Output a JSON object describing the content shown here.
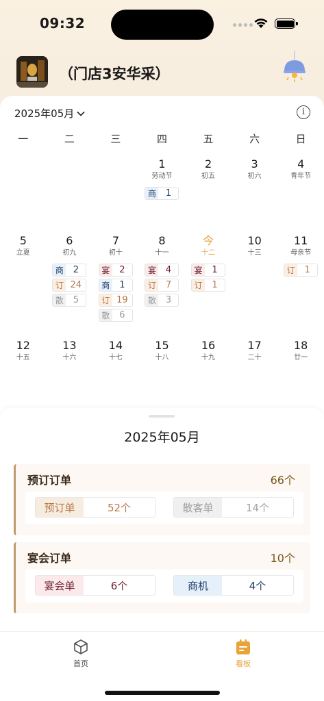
{
  "status_bar": {
    "time": "09:32"
  },
  "store": {
    "name": "（门店3安华采）"
  },
  "calendar": {
    "month_label": "2025年05月",
    "weekdays": [
      "一",
      "二",
      "三",
      "四",
      "五",
      "六",
      "日"
    ],
    "weeks": [
      [
        {
          "day": "",
          "sub": ""
        },
        {
          "day": "",
          "sub": ""
        },
        {
          "day": "",
          "sub": ""
        },
        {
          "day": "1",
          "sub": "劳动节",
          "badges": [
            {
              "type": "商",
              "count": "1"
            }
          ]
        },
        {
          "day": "2",
          "sub": "初五"
        },
        {
          "day": "3",
          "sub": "初六"
        },
        {
          "day": "4",
          "sub": "青年节"
        }
      ],
      [
        {
          "day": "5",
          "sub": "立夏"
        },
        {
          "day": "6",
          "sub": "初九",
          "badges": [
            {
              "type": "商",
              "count": "2"
            },
            {
              "type": "订",
              "count": "24"
            },
            {
              "type": "散",
              "count": "5"
            }
          ]
        },
        {
          "day": "7",
          "sub": "初十",
          "badges": [
            {
              "type": "宴",
              "count": "2"
            },
            {
              "type": "商",
              "count": "1"
            },
            {
              "type": "订",
              "count": "19"
            },
            {
              "type": "散",
              "count": "6"
            }
          ]
        },
        {
          "day": "8",
          "sub": "十一",
          "badges": [
            {
              "type": "宴",
              "count": "4"
            },
            {
              "type": "订",
              "count": "7"
            },
            {
              "type": "散",
              "count": "3"
            }
          ]
        },
        {
          "day": "今",
          "sub": "十二",
          "today": true,
          "badges": [
            {
              "type": "宴",
              "count": "1"
            },
            {
              "type": "订",
              "count": "1"
            }
          ]
        },
        {
          "day": "10",
          "sub": "十三"
        },
        {
          "day": "11",
          "sub": "母亲节",
          "badges": [
            {
              "type": "订",
              "count": "1"
            }
          ]
        }
      ],
      [
        {
          "day": "12",
          "sub": "十五"
        },
        {
          "day": "13",
          "sub": "十六"
        },
        {
          "day": "14",
          "sub": "十七"
        },
        {
          "day": "15",
          "sub": "十八"
        },
        {
          "day": "16",
          "sub": "十九"
        },
        {
          "day": "17",
          "sub": "二十"
        },
        {
          "day": "18",
          "sub": "廿一"
        }
      ]
    ]
  },
  "summary": {
    "title": "2025年05月",
    "reservation": {
      "label": "预订订单",
      "total": "66个",
      "items": [
        {
          "label": "预订单",
          "value": "52个"
        },
        {
          "label": "散客单",
          "value": "14个"
        }
      ]
    },
    "banquet": {
      "label": "宴会订单",
      "total": "10个",
      "items": [
        {
          "label": "宴会单",
          "value": "6个"
        },
        {
          "label": "商机",
          "value": "4个"
        }
      ]
    }
  },
  "tabs": [
    {
      "label": "首页",
      "icon": "cube-icon"
    },
    {
      "label": "看板",
      "icon": "board-icon"
    }
  ],
  "colors": {
    "accent": "#e8a43a",
    "banquet": "#6d1f2f",
    "business": "#1d3d66",
    "reservation": "#b6784a",
    "walkin": "#999999",
    "group_border": "#c09a6b"
  }
}
